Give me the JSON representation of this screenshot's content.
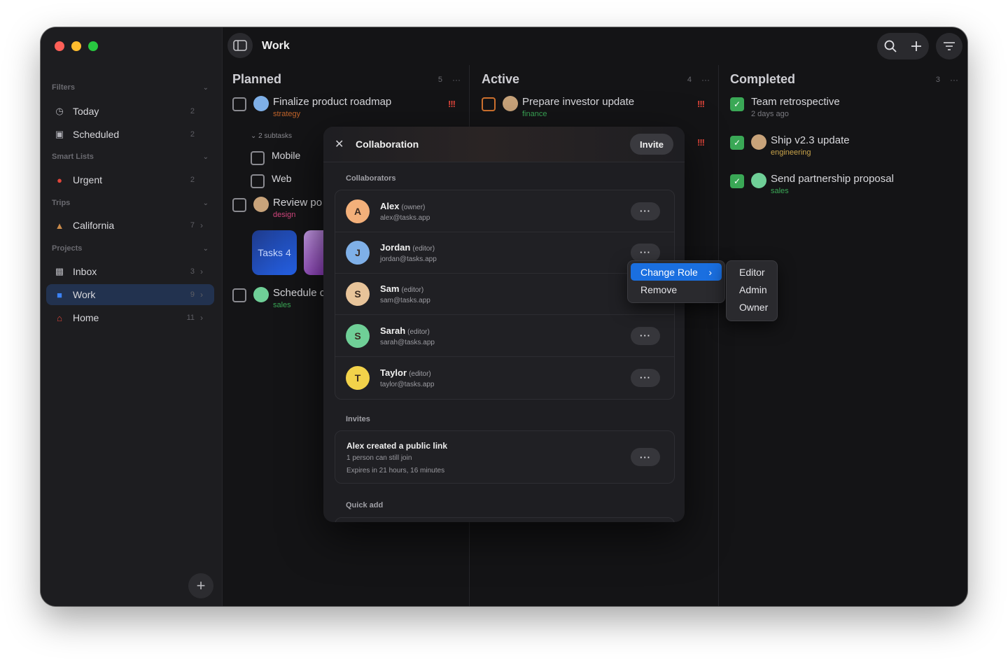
{
  "sidebar": {
    "sections": {
      "filters": "Filters",
      "smart_lists": "Smart Lists",
      "trips": "Trips",
      "projects": "Projects"
    },
    "items": [
      {
        "label": "Today",
        "count": "2",
        "icon": "clock-icon"
      },
      {
        "label": "Scheduled",
        "count": "2",
        "icon": "calendar-icon"
      },
      {
        "label": "Urgent",
        "count": "2",
        "icon": "flame-icon"
      },
      {
        "label": "California",
        "count": "7",
        "icon": "mountain-icon"
      },
      {
        "label": "Inbox",
        "count": "3",
        "icon": "inbox-icon"
      },
      {
        "label": "Work",
        "count": "9",
        "icon": "briefcase-icon"
      },
      {
        "label": "Home",
        "count": "11",
        "icon": "house-icon"
      }
    ],
    "add_label": "+"
  },
  "topbar": {
    "title": "Work"
  },
  "columns": {
    "planned": {
      "title": "Planned",
      "count": "5",
      "tasks": [
        {
          "title": "Finalize product roadmap",
          "tag": "strategy",
          "tag_color": "#c0632a"
        },
        {
          "title": "Review po",
          "tag": "design",
          "tag_color": "#d2467e"
        },
        {
          "title": "Schedule c",
          "tag": "sales",
          "tag_color": "#3aa856"
        }
      ],
      "subtasks_label": "2 subtasks",
      "subtasks": [
        "Mobile",
        "Web"
      ],
      "thumb_label": "Tasks 4"
    },
    "active": {
      "title": "Active",
      "count": "4",
      "tasks": [
        {
          "title": "Prepare investor update",
          "tag": "finance",
          "tag_color": "#3aa856"
        }
      ]
    },
    "completed": {
      "title": "Completed",
      "count": "3",
      "tasks": [
        {
          "title": "Team retrospective",
          "meta": "2 days ago"
        },
        {
          "title": "Ship v2.3 update",
          "tag": "engineering",
          "tag_color": "#c8a34a"
        },
        {
          "title": "Send partnership proposal",
          "tag": "sales",
          "tag_color": "#3aa856"
        }
      ]
    },
    "more": "···",
    "priority": "!!!"
  },
  "modal": {
    "title": "Collaboration",
    "invite_label": "Invite",
    "collaborators_label": "Collaborators",
    "collaborators": [
      {
        "name": "Alex",
        "role": "(owner)",
        "email": "alex@tasks.app",
        "color": "#f3b07a",
        "initial": "A"
      },
      {
        "name": "Jordan",
        "role": "(editor)",
        "email": "jordan@tasks.app",
        "color": "#7fb0e8",
        "initial": "J"
      },
      {
        "name": "Sam",
        "role": "(editor)",
        "email": "sam@tasks.app",
        "color": "#e8c49a",
        "initial": "S"
      },
      {
        "name": "Sarah",
        "role": "(editor)",
        "email": "sarah@tasks.app",
        "color": "#6fcf97",
        "initial": "S"
      },
      {
        "name": "Taylor",
        "role": "(editor)",
        "email": "taylor@tasks.app",
        "color": "#f2d24a",
        "initial": "T"
      }
    ],
    "dots": "···",
    "invites_label": "Invites",
    "invite_link": {
      "title": "Alex created a public link",
      "line1": "1 person can still join",
      "line2": "Expires in 21 hours, 16 minutes"
    },
    "quick_add_label": "Quick add"
  },
  "context_menu": {
    "items": [
      "Change Role",
      "Remove"
    ],
    "submenu": [
      "Editor",
      "Admin",
      "Owner"
    ]
  }
}
